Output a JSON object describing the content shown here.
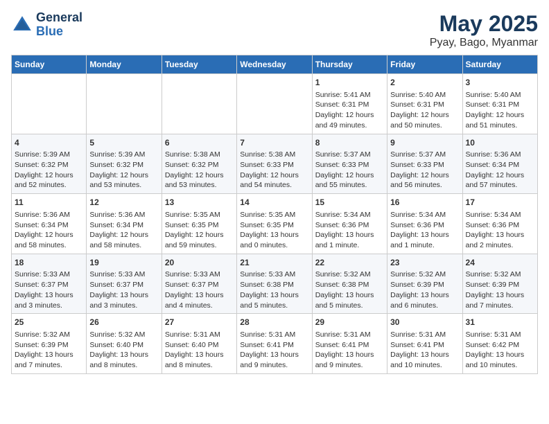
{
  "header": {
    "logo_general": "General",
    "logo_blue": "Blue",
    "title": "May 2025",
    "subtitle": "Pyay, Bago, Myanmar"
  },
  "days_of_week": [
    "Sunday",
    "Monday",
    "Tuesday",
    "Wednesday",
    "Thursday",
    "Friday",
    "Saturday"
  ],
  "weeks": [
    [
      {
        "day": "",
        "info": ""
      },
      {
        "day": "",
        "info": ""
      },
      {
        "day": "",
        "info": ""
      },
      {
        "day": "",
        "info": ""
      },
      {
        "day": "1",
        "info": "Sunrise: 5:41 AM\nSunset: 6:31 PM\nDaylight: 12 hours\nand 49 minutes."
      },
      {
        "day": "2",
        "info": "Sunrise: 5:40 AM\nSunset: 6:31 PM\nDaylight: 12 hours\nand 50 minutes."
      },
      {
        "day": "3",
        "info": "Sunrise: 5:40 AM\nSunset: 6:31 PM\nDaylight: 12 hours\nand 51 minutes."
      }
    ],
    [
      {
        "day": "4",
        "info": "Sunrise: 5:39 AM\nSunset: 6:32 PM\nDaylight: 12 hours\nand 52 minutes."
      },
      {
        "day": "5",
        "info": "Sunrise: 5:39 AM\nSunset: 6:32 PM\nDaylight: 12 hours\nand 53 minutes."
      },
      {
        "day": "6",
        "info": "Sunrise: 5:38 AM\nSunset: 6:32 PM\nDaylight: 12 hours\nand 53 minutes."
      },
      {
        "day": "7",
        "info": "Sunrise: 5:38 AM\nSunset: 6:33 PM\nDaylight: 12 hours\nand 54 minutes."
      },
      {
        "day": "8",
        "info": "Sunrise: 5:37 AM\nSunset: 6:33 PM\nDaylight: 12 hours\nand 55 minutes."
      },
      {
        "day": "9",
        "info": "Sunrise: 5:37 AM\nSunset: 6:33 PM\nDaylight: 12 hours\nand 56 minutes."
      },
      {
        "day": "10",
        "info": "Sunrise: 5:36 AM\nSunset: 6:34 PM\nDaylight: 12 hours\nand 57 minutes."
      }
    ],
    [
      {
        "day": "11",
        "info": "Sunrise: 5:36 AM\nSunset: 6:34 PM\nDaylight: 12 hours\nand 58 minutes."
      },
      {
        "day": "12",
        "info": "Sunrise: 5:36 AM\nSunset: 6:34 PM\nDaylight: 12 hours\nand 58 minutes."
      },
      {
        "day": "13",
        "info": "Sunrise: 5:35 AM\nSunset: 6:35 PM\nDaylight: 12 hours\nand 59 minutes."
      },
      {
        "day": "14",
        "info": "Sunrise: 5:35 AM\nSunset: 6:35 PM\nDaylight: 13 hours\nand 0 minutes."
      },
      {
        "day": "15",
        "info": "Sunrise: 5:34 AM\nSunset: 6:36 PM\nDaylight: 13 hours\nand 1 minute."
      },
      {
        "day": "16",
        "info": "Sunrise: 5:34 AM\nSunset: 6:36 PM\nDaylight: 13 hours\nand 1 minute."
      },
      {
        "day": "17",
        "info": "Sunrise: 5:34 AM\nSunset: 6:36 PM\nDaylight: 13 hours\nand 2 minutes."
      }
    ],
    [
      {
        "day": "18",
        "info": "Sunrise: 5:33 AM\nSunset: 6:37 PM\nDaylight: 13 hours\nand 3 minutes."
      },
      {
        "day": "19",
        "info": "Sunrise: 5:33 AM\nSunset: 6:37 PM\nDaylight: 13 hours\nand 3 minutes."
      },
      {
        "day": "20",
        "info": "Sunrise: 5:33 AM\nSunset: 6:37 PM\nDaylight: 13 hours\nand 4 minutes."
      },
      {
        "day": "21",
        "info": "Sunrise: 5:33 AM\nSunset: 6:38 PM\nDaylight: 13 hours\nand 5 minutes."
      },
      {
        "day": "22",
        "info": "Sunrise: 5:32 AM\nSunset: 6:38 PM\nDaylight: 13 hours\nand 5 minutes."
      },
      {
        "day": "23",
        "info": "Sunrise: 5:32 AM\nSunset: 6:39 PM\nDaylight: 13 hours\nand 6 minutes."
      },
      {
        "day": "24",
        "info": "Sunrise: 5:32 AM\nSunset: 6:39 PM\nDaylight: 13 hours\nand 7 minutes."
      }
    ],
    [
      {
        "day": "25",
        "info": "Sunrise: 5:32 AM\nSunset: 6:39 PM\nDaylight: 13 hours\nand 7 minutes."
      },
      {
        "day": "26",
        "info": "Sunrise: 5:32 AM\nSunset: 6:40 PM\nDaylight: 13 hours\nand 8 minutes."
      },
      {
        "day": "27",
        "info": "Sunrise: 5:31 AM\nSunset: 6:40 PM\nDaylight: 13 hours\nand 8 minutes."
      },
      {
        "day": "28",
        "info": "Sunrise: 5:31 AM\nSunset: 6:41 PM\nDaylight: 13 hours\nand 9 minutes."
      },
      {
        "day": "29",
        "info": "Sunrise: 5:31 AM\nSunset: 6:41 PM\nDaylight: 13 hours\nand 9 minutes."
      },
      {
        "day": "30",
        "info": "Sunrise: 5:31 AM\nSunset: 6:41 PM\nDaylight: 13 hours\nand 10 minutes."
      },
      {
        "day": "31",
        "info": "Sunrise: 5:31 AM\nSunset: 6:42 PM\nDaylight: 13 hours\nand 10 minutes."
      }
    ]
  ]
}
